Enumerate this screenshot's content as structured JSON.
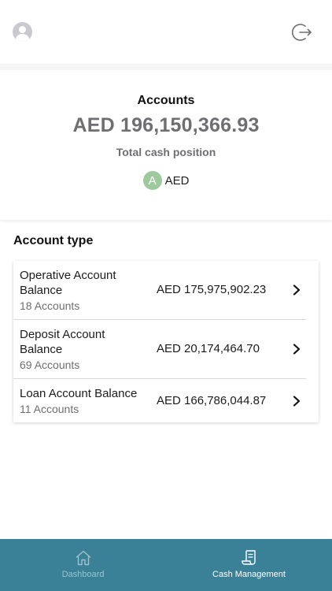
{
  "header": {
    "avatar_icon": "user-avatar-icon",
    "logout_icon": "logout-icon"
  },
  "summary": {
    "title": "Accounts",
    "total": "AED 196,150,366.93",
    "subtitle": "Total cash position",
    "currency_badge": "A",
    "currency_code": "AED",
    "badge_color": "#9ec99e"
  },
  "section": {
    "title": "Account type"
  },
  "accounts": [
    {
      "name": "Operative Account Balance",
      "count": "18 Accounts",
      "amount": "AED 175,975,902.23"
    },
    {
      "name": "Deposit Account Balance",
      "count": "69 Accounts",
      "amount": "AED 20,174,464.70"
    },
    {
      "name": "Loan Account Balance",
      "count": "11 Accounts",
      "amount": "AED 166,786,044.87"
    }
  ],
  "tabbar": {
    "color": "#3a8096",
    "tabs": [
      {
        "label": "Dashboard",
        "icon": "home-icon",
        "active": false
      },
      {
        "label": "Cash Management",
        "icon": "document-icon",
        "active": true
      }
    ]
  }
}
